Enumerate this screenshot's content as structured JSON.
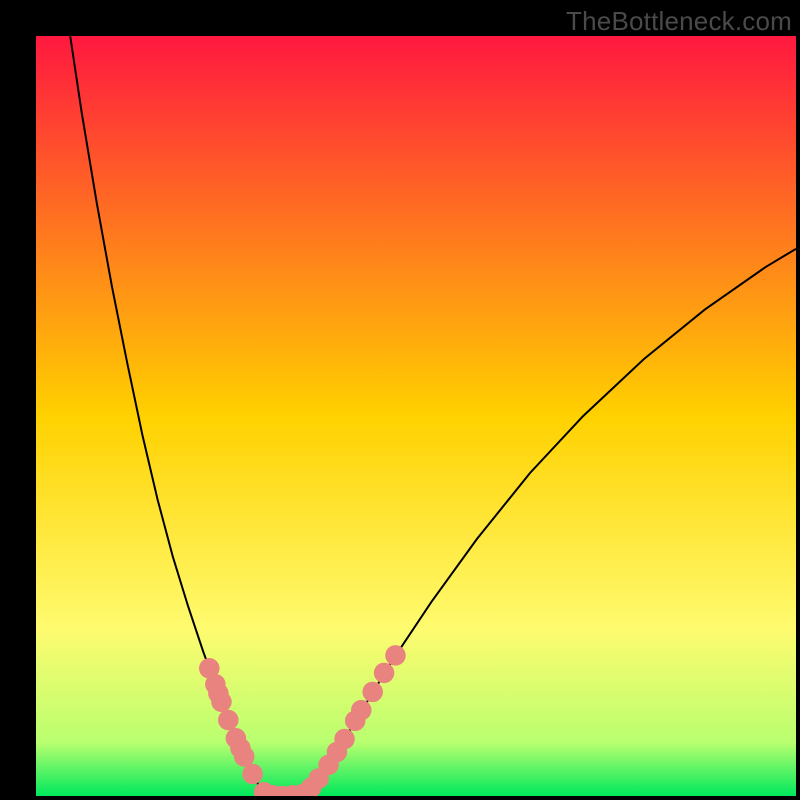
{
  "watermark": "TheBottleneck.com",
  "chart_data": {
    "type": "line",
    "title": "",
    "xlabel": "",
    "ylabel": "",
    "xlim": [
      0,
      100
    ],
    "ylim": [
      0,
      100
    ],
    "gradient_stops": [
      {
        "offset": 0,
        "color": "#ff183f"
      },
      {
        "offset": 50,
        "color": "#ffd100"
      },
      {
        "offset": 78,
        "color": "#fffb6f"
      },
      {
        "offset": 93,
        "color": "#b8ff6f"
      },
      {
        "offset": 100,
        "color": "#00e85c"
      }
    ],
    "series": [
      {
        "name": "left-arm",
        "stroke": "#000000",
        "x": [
          4.5,
          6,
          8,
          10,
          12,
          14,
          16,
          18,
          20,
          22,
          24,
          25.5,
          27,
          28.2,
          29.2,
          30
        ],
        "y": [
          100,
          90,
          78,
          67,
          57,
          47.5,
          39,
          31.5,
          25,
          19,
          13.5,
          9.5,
          6.2,
          3.6,
          1.6,
          0.2
        ]
      },
      {
        "name": "valley-floor",
        "stroke": "#000000",
        "x": [
          30,
          31,
          32,
          33,
          34,
          35
        ],
        "y": [
          0.2,
          0.05,
          0.0,
          0.0,
          0.05,
          0.2
        ]
      },
      {
        "name": "right-arm",
        "stroke": "#000000",
        "x": [
          35,
          36.5,
          38,
          40,
          43,
          47,
          52,
          58,
          65,
          72,
          80,
          88,
          96,
          100
        ],
        "y": [
          0.2,
          1.5,
          3.4,
          6.5,
          11.5,
          18,
          25.5,
          33.8,
          42.5,
          50,
          57.5,
          64,
          69.6,
          72
        ]
      }
    ],
    "dots": {
      "color": "#e8837f",
      "radius": 1.35,
      "points": [
        {
          "x": 22.8,
          "y": 16.8
        },
        {
          "x": 23.6,
          "y": 14.7
        },
        {
          "x": 24.0,
          "y": 13.5
        },
        {
          "x": 24.4,
          "y": 12.4
        },
        {
          "x": 25.3,
          "y": 10.0
        },
        {
          "x": 26.3,
          "y": 7.6
        },
        {
          "x": 26.9,
          "y": 6.3
        },
        {
          "x": 27.4,
          "y": 5.2
        },
        {
          "x": 28.5,
          "y": 2.9
        },
        {
          "x": 30.0,
          "y": 0.5
        },
        {
          "x": 31.2,
          "y": 0.1
        },
        {
          "x": 32.5,
          "y": 0.0
        },
        {
          "x": 33.8,
          "y": 0.1
        },
        {
          "x": 35.2,
          "y": 0.3
        },
        {
          "x": 36.2,
          "y": 1.1
        },
        {
          "x": 37.2,
          "y": 2.3
        },
        {
          "x": 38.5,
          "y": 4.1
        },
        {
          "x": 39.6,
          "y": 5.8
        },
        {
          "x": 40.6,
          "y": 7.5
        },
        {
          "x": 42.0,
          "y": 9.9
        },
        {
          "x": 42.8,
          "y": 11.3
        },
        {
          "x": 44.3,
          "y": 13.7
        },
        {
          "x": 45.8,
          "y": 16.2
        },
        {
          "x": 47.3,
          "y": 18.5
        }
      ]
    }
  }
}
